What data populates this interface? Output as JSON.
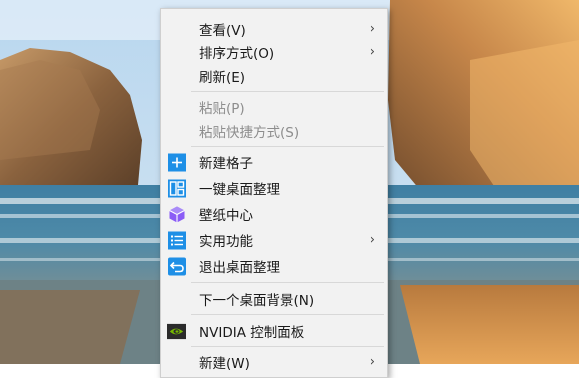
{
  "menu": {
    "items": [
      {
        "label": "查看(V)",
        "submenu": true
      },
      {
        "label": "排序方式(O)",
        "submenu": true
      },
      {
        "label": "刷新(E)"
      },
      {
        "label": "粘贴(P)",
        "disabled": true
      },
      {
        "label": "粘贴快捷方式(S)",
        "disabled": true
      },
      {
        "label": "新建格子",
        "icon": "plus-square-icon"
      },
      {
        "label": "一键桌面整理",
        "icon": "layout-grid-icon"
      },
      {
        "label": "壁纸中心",
        "icon": "cube-icon"
      },
      {
        "label": "实用功能",
        "icon": "list-icon",
        "submenu": true
      },
      {
        "label": "退出桌面整理",
        "icon": "return-arrow-icon"
      },
      {
        "label": "下一个桌面背景(N)"
      },
      {
        "label": "NVIDIA 控制面板",
        "icon": "nvidia-logo-icon"
      },
      {
        "label": "新建(W)",
        "submenu": true
      }
    ],
    "submenu_glyph": "›",
    "accent_color": "#1e8fe6",
    "wallpaper_cube_color": "#8b5cf6"
  }
}
